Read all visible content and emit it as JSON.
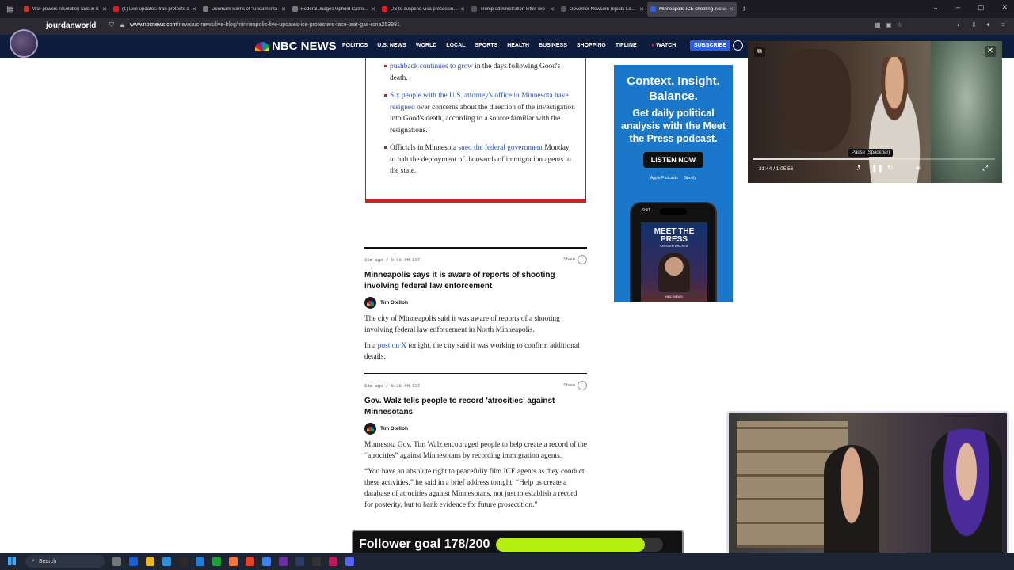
{
  "browser": {
    "tabs": [
      {
        "label": "War powers resolution fails in S",
        "color": "#c0392b",
        "active": false
      },
      {
        "label": "(1) Live updates: Iran protests a",
        "color": "#e51d2a",
        "active": false
      },
      {
        "label": "Denmark warns of 'fundamenta",
        "color": "#7a7a7a",
        "active": false
      },
      {
        "label": "Federal Judges Uphold Californi",
        "color": "#7a7a7a",
        "active": false
      },
      {
        "label": "US to suspend visa processing f",
        "color": "#e51d2a",
        "active": false
      },
      {
        "label": "Trump administration letter wip",
        "color": "#555555",
        "active": false
      },
      {
        "label": "Governor Newsom rejects Louis",
        "color": "#555555",
        "active": false
      },
      {
        "label": "Minneapolis ICE shooting live u",
        "color": "#2d5fe6",
        "active": true
      }
    ],
    "profile_name": "jourdanworld",
    "url_domain": "www.nbcnews.com",
    "url_path": "/news/us-news/live-blog/minneapolis-live-updates-ice-protesters-face-tear-gas-rcna253991"
  },
  "nbc": {
    "logo_text": "NBC NEWS",
    "menu": [
      "POLITICS",
      "U.S. NEWS",
      "WORLD",
      "LOCAL",
      "SPORTS",
      "HEALTH",
      "BUSINESS",
      "SHOPPING",
      "TIPLINE"
    ],
    "watch_label": "WATCH",
    "subscribe_label": "SUBSCRIBE"
  },
  "summary_box": {
    "b1_link": "pushback continues to grow",
    "b1_text": " in the days following Good's death.",
    "b2_link": "Six people with the U.S. attorney's office in Minnesota have resigned",
    "b2_text": " over concerns about the direction of the investigation into Good's death, according to a source familiar with the resignations.",
    "b3_pre": "Officials in Minnesota ",
    "b3_link": "sued the federal government",
    "b3_text": " Monday to halt the deployment of thousands of immigration agents to the state."
  },
  "posts": [
    {
      "time": "28m ago / 9:00 PM EST",
      "share": "Share",
      "headline": "Minneapolis says it is aware of reports of shooting involving federal law enforcement",
      "author": "Tim Stelloh",
      "p1": "The city of Minneapolis said it was aware of reports of a shooting involving federal law enforcement in North Minneapolis.",
      "p2_pre": "In a ",
      "p2_link": "post on X",
      "p2_text": " tonight, the city said it was working to confirm additional details."
    },
    {
      "time": "51m ago / 8:36 PM EST",
      "share": "Share",
      "headline": "Gov. Walz tells people to record 'atrocities' against Minnesotans",
      "author": "Tim Stelloh",
      "p1": "Minnesota Gov. Tim Walz encouraged people to help create a record of the “atrocities” against Minnesotans by recording immigration agents.",
      "p2": "“You have an absolute right to peacefully film ICE agents as they conduct these activities,” he said in a brief address tonight. “Help us create a database of atrocities against Minnesotans, not just to establish a record for posterity, but to bank evidence for future prosecution.”"
    }
  ],
  "ad": {
    "headline": "Context. Insight. Balance.",
    "sub": "Get daily political analysis with the Meet the Press podcast.",
    "button": "LISTEN NOW",
    "store1": "Apple Podcasts",
    "store2": "Spotify",
    "phone_time": "9:41",
    "show_title": "MEET THE PRESS",
    "host": "KRISTEN WELKER",
    "badge": "NBC NEWS"
  },
  "video": {
    "time": "31:44 / 1:05:56",
    "tooltip": "Pause (Spacebar)",
    "progress_fraction": 0.485
  },
  "stream": {
    "goal_label": "Follower goal 178/200",
    "goal_fraction": 0.89
  },
  "taskbar": {
    "search_label": "Search"
  }
}
